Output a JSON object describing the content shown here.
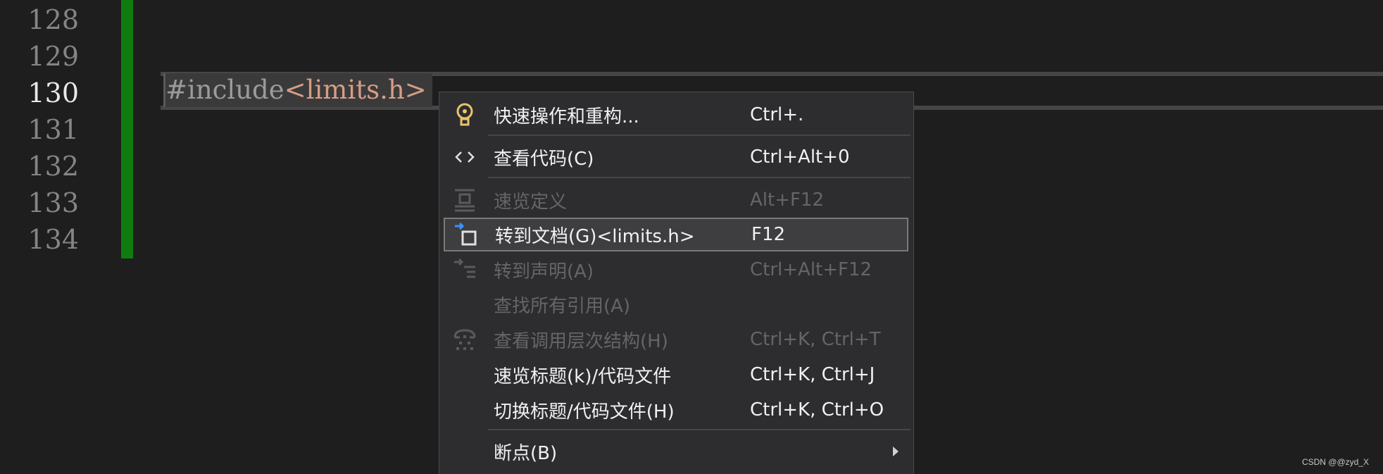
{
  "gutter": {
    "lines": [
      "128",
      "129",
      "130",
      "131",
      "132",
      "133",
      "134"
    ],
    "active_line": "130"
  },
  "code": {
    "directive": "#include",
    "header": "<limits.h>"
  },
  "context_menu": {
    "items": [
      {
        "label": "快速操作和重构...",
        "shortcut": "Ctrl+.",
        "icon": "lightbulb-icon",
        "enabled": true
      },
      {
        "label": "查看代码(C)",
        "shortcut": "Ctrl+Alt+0",
        "icon": "code-brackets-icon",
        "enabled": true
      },
      {
        "label": "速览定义",
        "shortcut": "Alt+F12",
        "icon": "peek-definition-icon",
        "enabled": false
      },
      {
        "label": "转到文档(G)<limits.h>",
        "shortcut": "F12",
        "icon": "go-to-document-icon",
        "enabled": true,
        "highlighted": true
      },
      {
        "label": "转到声明(A)",
        "shortcut": "Ctrl+Alt+F12",
        "icon": "go-to-declaration-icon",
        "enabled": false
      },
      {
        "label": "查找所有引用(A)",
        "shortcut": "",
        "icon": "",
        "enabled": false
      },
      {
        "label": "查看调用层次结构(H)",
        "shortcut": "Ctrl+K, Ctrl+T",
        "icon": "call-hierarchy-icon",
        "enabled": false
      },
      {
        "label": "速览标题(k)/代码文件",
        "shortcut": "Ctrl+K, Ctrl+J",
        "icon": "",
        "enabled": true
      },
      {
        "label": "切换标题/代码文件(H)",
        "shortcut": "Ctrl+K, Ctrl+O",
        "icon": "",
        "enabled": true
      },
      {
        "label": "断点(B)",
        "shortcut": "",
        "icon": "submenu-arrow-icon",
        "enabled": true
      }
    ]
  },
  "watermark": "CSDN @@zyd_X"
}
